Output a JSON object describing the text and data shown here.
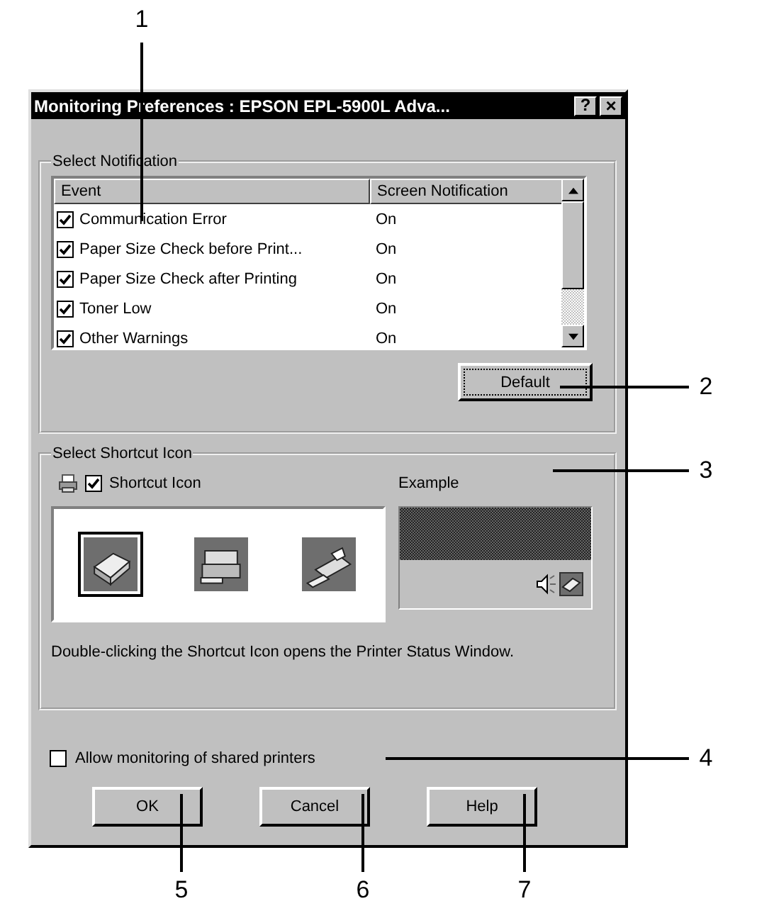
{
  "window": {
    "title": "Monitoring Preferences : EPSON EPL-5900L Adva...",
    "title_buttons": [
      {
        "kind": "help",
        "label": "?"
      },
      {
        "kind": "close",
        "label": "×"
      }
    ]
  },
  "notification_group": {
    "title": "Select Notification",
    "columns": [
      "Event",
      "Screen Notification"
    ],
    "rows": [
      {
        "event": "Communication Error",
        "checked": true,
        "screen_notification": "On"
      },
      {
        "event": "Paper Size Check before Print...",
        "checked": true,
        "screen_notification": "On"
      },
      {
        "event": "Paper Size Check after Printing",
        "checked": true,
        "screen_notification": "On"
      },
      {
        "event": "Toner Low",
        "checked": true,
        "screen_notification": "On"
      },
      {
        "event": "Other Warnings",
        "checked": true,
        "screen_notification": "On"
      }
    ],
    "default_button": "Default"
  },
  "shortcut_group": {
    "title": "Select Shortcut Icon",
    "checkbox": {
      "label": "Shortcut Icon",
      "checked": true
    },
    "icons": [
      {
        "selected": true
      },
      {
        "selected": false
      },
      {
        "selected": false
      }
    ],
    "example_label": "Example",
    "description": "Double-clicking the Shortcut Icon opens the Printer Status Window."
  },
  "shared_printers": {
    "label": "Allow monitoring of shared printers",
    "checked": false
  },
  "buttons": [
    "OK",
    "Cancel",
    "Help"
  ],
  "callouts": [
    {
      "label": "1"
    },
    {
      "label": "2"
    },
    {
      "label": "3"
    },
    {
      "label": "4"
    },
    {
      "label": "5"
    },
    {
      "label": "6"
    },
    {
      "label": "7"
    }
  ]
}
